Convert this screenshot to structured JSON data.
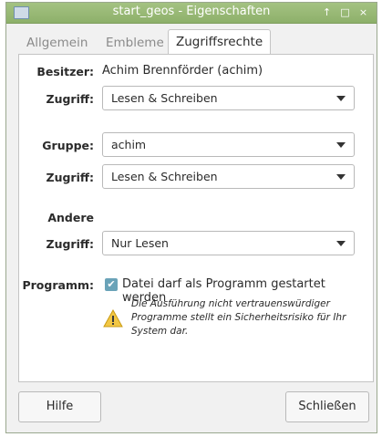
{
  "window": {
    "title": "start_geos - Eigenschaften",
    "controls": {
      "up": "↑",
      "maximize": "□",
      "close": "×"
    }
  },
  "tabs": [
    {
      "label": "Allgemein",
      "active": false
    },
    {
      "label": "Embleme",
      "active": false
    },
    {
      "label": "Zugriffsrechte",
      "active": true
    }
  ],
  "owner": {
    "label": "Besitzer:",
    "value": "Achim Brennförder (achim)",
    "access_label": "Zugriff:",
    "access_value": "Lesen & Schreiben"
  },
  "group": {
    "label": "Gruppe:",
    "value": "achim",
    "access_label": "Zugriff:",
    "access_value": "Lesen & Schreiben"
  },
  "others": {
    "label": "Andere",
    "access_label": "Zugriff:",
    "access_value": "Nur Lesen"
  },
  "program": {
    "label": "Programm:",
    "checkbox_label": "Datei darf als Programm gestartet werden",
    "checked": true,
    "warning_line1": "Die Ausführung nicht vertrauenswürdiger",
    "warning_line2": "Programme stellt ein Sicherheitsrisiko für Ihr",
    "warning_line3": "System dar."
  },
  "buttons": {
    "help": "Hilfe",
    "close": "Schließen"
  },
  "colors": {
    "titlebar": "#9bbb78",
    "checkbox": "#6aa3b8",
    "warning": "#f2c744"
  }
}
